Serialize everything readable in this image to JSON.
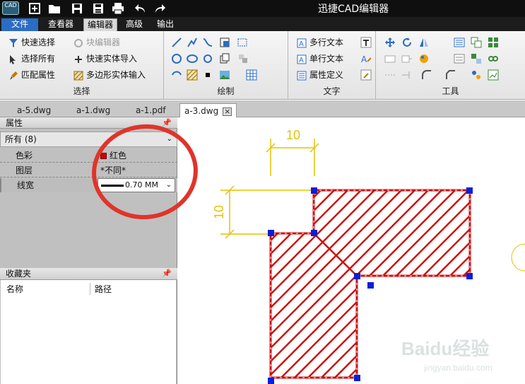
{
  "window": {
    "logo_text": "CAD",
    "title": "迅捷CAD编辑器"
  },
  "quick_access": [
    "new-icon",
    "open-icon",
    "save-icon",
    "save-as-icon",
    "print-icon",
    "undo-icon",
    "redo-icon"
  ],
  "menu_tabs": [
    {
      "label": "文件"
    },
    {
      "label": "查看器"
    },
    {
      "label": "编辑器"
    },
    {
      "label": "高级"
    },
    {
      "label": "输出"
    }
  ],
  "ribbon": {
    "select_group": {
      "label": "选择",
      "items": [
        "快速选择",
        "选择所有",
        "匹配属性"
      ],
      "items2": [
        "块编辑器",
        "快速实体导入",
        "多边形实体输入"
      ]
    },
    "draw_group": {
      "label": "绘制"
    },
    "text_group": {
      "label": "文字",
      "items": [
        "多行文本",
        "单行文本",
        "属性定义"
      ]
    },
    "tools_group": {
      "label": "工具"
    }
  },
  "doc_tabs": [
    {
      "label": "a-5.dwg"
    },
    {
      "label": "a-1.dwg"
    },
    {
      "label": "a-1.pdf"
    },
    {
      "label": "a-3.dwg"
    }
  ],
  "properties": {
    "title": "属性",
    "selection": "所有 (8)",
    "rows": [
      {
        "name": "色彩",
        "value": "红色"
      },
      {
        "name": "图层",
        "value": "*不同*"
      },
      {
        "name": "线宽",
        "value": "0.70 MM"
      }
    ],
    "color_value_hex": "#d20000"
  },
  "favorites": {
    "title": "收藏夹",
    "columns": [
      "名称",
      "路径"
    ]
  },
  "drawing": {
    "dim_horizontal": "10",
    "dim_vertical": "10"
  },
  "watermark": {
    "brand": "Baidu经验",
    "url": "jingyan.baidu.com"
  },
  "colors": {
    "accent": "#2b6cc4",
    "hatch": "#cc1111",
    "dimension": "#e6c200",
    "grip": "#0a1fd6",
    "annotation": "#e0342a"
  }
}
